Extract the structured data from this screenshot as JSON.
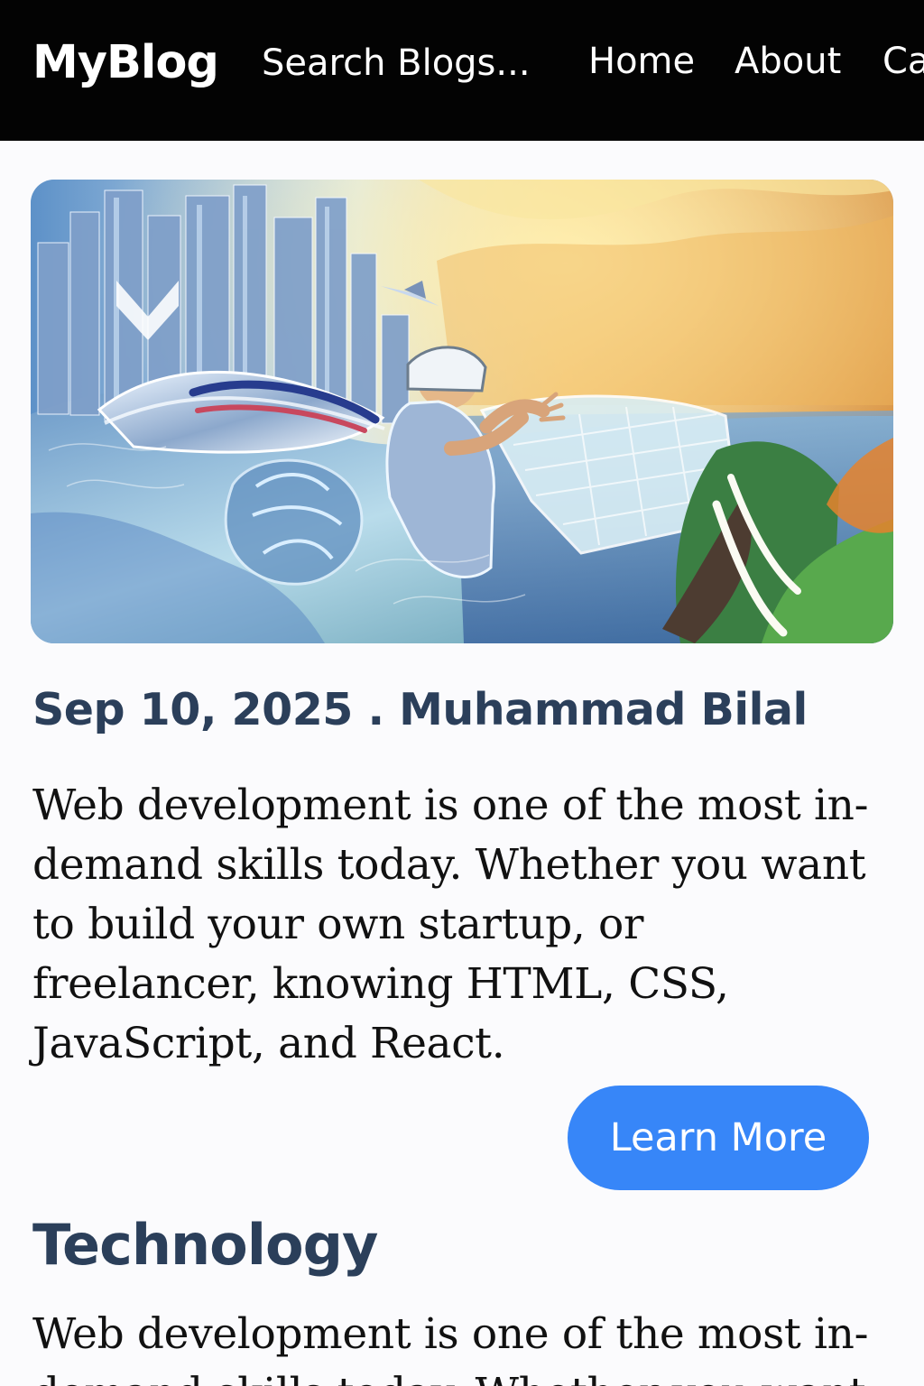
{
  "navbar": {
    "brand": "MyBlog",
    "search_placeholder": "Search Blogs...",
    "links": [
      {
        "label": "Home"
      },
      {
        "label": "About"
      },
      {
        "label": "Categories"
      }
    ]
  },
  "featured_post": {
    "image": {
      "alt": "Futuristic technology illustration"
    },
    "meta": "Sep 10, 2025 . Muhammad Bilal",
    "excerpt": "Web development is one of the most in-demand skills today. Whether you want to build your own startup, or freelancer, knowing HTML, CSS, JavaScript, and React.",
    "button_label": "Learn More"
  },
  "section": {
    "title": "Technology",
    "excerpt": "Web development is one of the most in-demand skills today. Whether you want"
  },
  "colors": {
    "navbar_background": "#030303",
    "page_background": "#fbfbfd",
    "heading_text": "#2b3f5a",
    "body_text": "#111111",
    "button_background": "#3786f8"
  },
  "icons": []
}
